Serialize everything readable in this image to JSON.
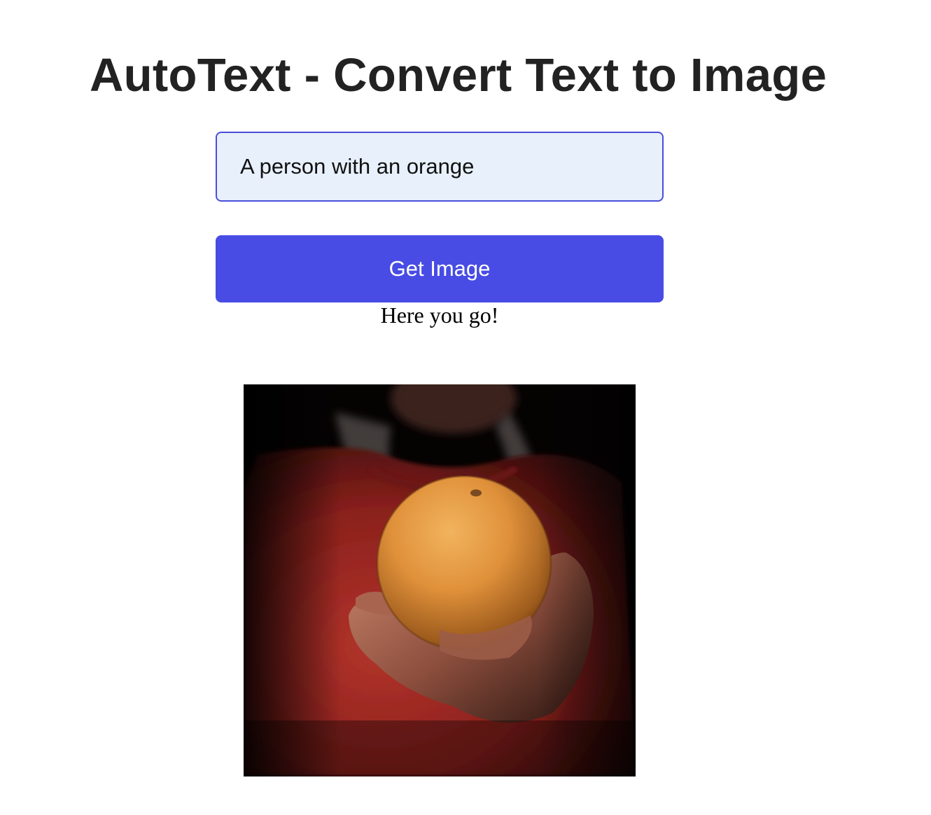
{
  "header": {
    "title": "AutoText - Convert Text to Image"
  },
  "form": {
    "prompt_value": "A person with an orange",
    "button_label": "Get Image"
  },
  "result": {
    "message": "Here you go!",
    "image_alt": "A person with an orange"
  },
  "colors": {
    "title": "#222222",
    "input_border": "#4a4ed8",
    "input_background": "#e8f0fc",
    "button_background": "#484ce4",
    "button_text": "#ffffff"
  }
}
